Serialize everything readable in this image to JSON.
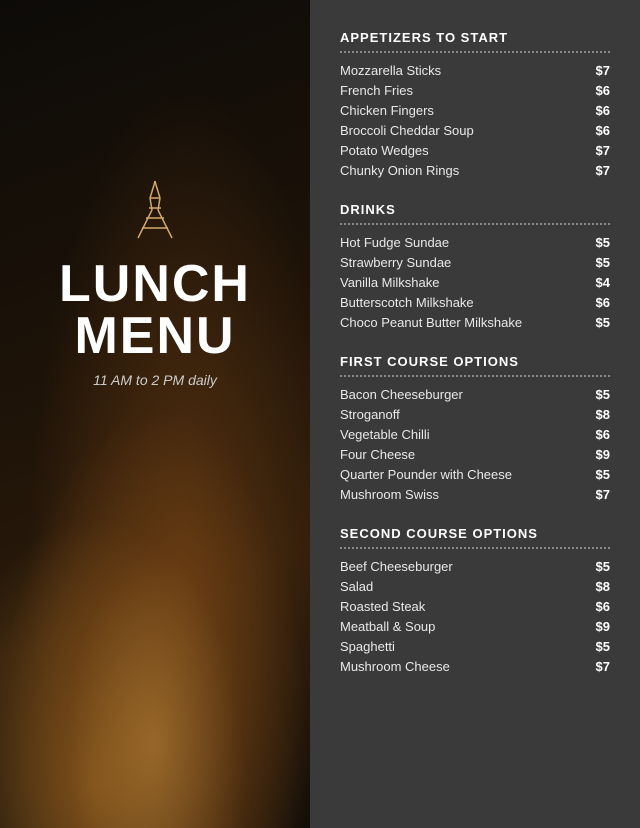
{
  "left": {
    "icon_label": "eiffel-tower",
    "title_line1": "LUNCH",
    "title_line2": "MENU",
    "hours": "11 AM to 2 PM daily"
  },
  "right": {
    "sections": [
      {
        "id": "appetizers",
        "title": "APPETIZERS TO START",
        "items": [
          {
            "name": "Mozzarella Sticks",
            "price": "$7"
          },
          {
            "name": "French Fries",
            "price": "$6"
          },
          {
            "name": "Chicken Fingers",
            "price": "$6"
          },
          {
            "name": "Broccoli Cheddar Soup",
            "price": "$6"
          },
          {
            "name": "Potato Wedges",
            "price": "$7"
          },
          {
            "name": "Chunky Onion Rings",
            "price": "$7"
          }
        ]
      },
      {
        "id": "drinks",
        "title": "DRINKS",
        "items": [
          {
            "name": "Hot Fudge Sundae",
            "price": "$5"
          },
          {
            "name": "Strawberry Sundae",
            "price": "$5"
          },
          {
            "name": "Vanilla Milkshake",
            "price": "$4"
          },
          {
            "name": "Butterscotch Milkshake",
            "price": "$6"
          },
          {
            "name": "Choco Peanut Butter Milkshake",
            "price": "$5"
          }
        ]
      },
      {
        "id": "first-course",
        "title": "FIRST COURSE OPTIONS",
        "items": [
          {
            "name": "Bacon Cheeseburger",
            "price": "$5"
          },
          {
            "name": "Stroganoff",
            "price": "$8"
          },
          {
            "name": "Vegetable Chilli",
            "price": "$6"
          },
          {
            "name": "Four Cheese",
            "price": "$9"
          },
          {
            "name": "Quarter Pounder with Cheese",
            "price": "$5"
          },
          {
            "name": "Mushroom Swiss",
            "price": "$7"
          }
        ]
      },
      {
        "id": "second-course",
        "title": "SECOND COURSE OPTIONS",
        "items": [
          {
            "name": "Beef Cheeseburger",
            "price": "$5"
          },
          {
            "name": "Salad",
            "price": "$8"
          },
          {
            "name": "Roasted Steak",
            "price": "$6"
          },
          {
            "name": "Meatball & Soup",
            "price": "$9"
          },
          {
            "name": "Spaghetti",
            "price": "$5"
          },
          {
            "name": "Mushroom Cheese",
            "price": "$7"
          }
        ]
      }
    ]
  }
}
